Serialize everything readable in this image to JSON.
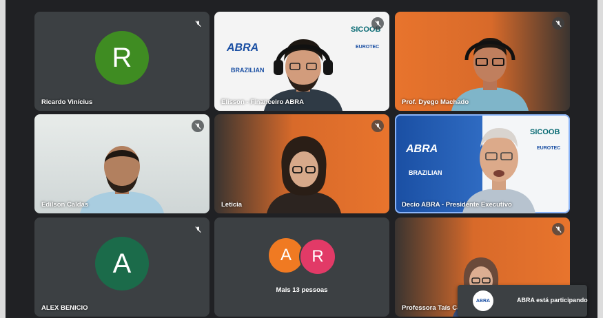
{
  "participants": [
    {
      "name": "Ricardo Vinícius",
      "initial": "R",
      "avatar_color": "#3f8c22"
    },
    {
      "name": "Elisson - Financeiro ABRA",
      "sponsor_top": "SICOOB",
      "sponsor_mid": "EUROTEC",
      "brand": "ABRA",
      "brand2": "BRAZILIAN"
    },
    {
      "name": "Prof. Dyego Machado"
    },
    {
      "name": "Edilson Caldas"
    },
    {
      "name": "Leticia"
    },
    {
      "name": "Decio ABRA - Presidente Executivo",
      "sponsor_top": "SICOOB",
      "sponsor_mid": "EUROTEC",
      "brand": "ABRA",
      "brand2": "BRAZILIAN"
    },
    {
      "name": "ALEX BENICIO",
      "initial": "A",
      "avatar_color": "#1b6b4a"
    },
    {
      "more_label": "Mais 13 pessoas",
      "initials": [
        "A",
        "R"
      ],
      "avatar_colors": [
        "#f07a22",
        "#e23a67"
      ]
    },
    {
      "name": "Professora Taís Capra"
    }
  ],
  "toast": {
    "logo": "ABRA",
    "text": "ABRA está participando"
  },
  "colors": {
    "tile_bg": "#3c4043",
    "orange": "#e8742d",
    "active_outline": "#8ab4f8"
  }
}
